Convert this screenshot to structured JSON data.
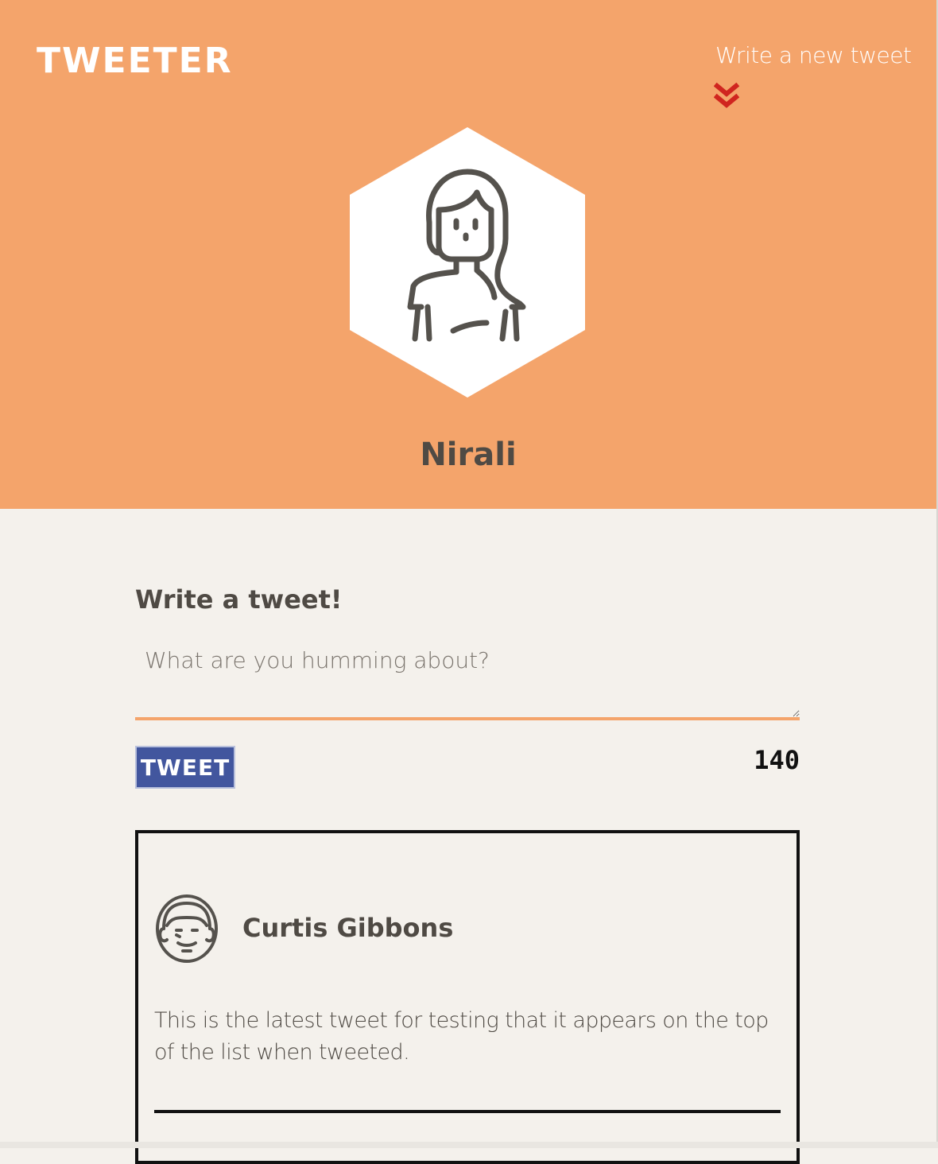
{
  "nav": {
    "logo": "TWEETER",
    "compose_link": "Write a new tweet",
    "compose_icon": "double-chevron-down-icon"
  },
  "profile": {
    "name": "Nirali",
    "avatar_icon": "woman-avatar-icon"
  },
  "compose": {
    "title": "Write a tweet!",
    "placeholder": "What are you humming about?",
    "button_label": "TWEET",
    "counter": "140"
  },
  "tweets": [
    {
      "author": "Curtis Gibbons",
      "avatar_icon": "man-avatar-icon",
      "text": "This is the latest tweet for testing that it appears on the top of the list when tweeted."
    }
  ],
  "colors": {
    "header_bg": "#f4a46b",
    "page_bg": "#f4f1ec",
    "button_bg": "#42569e",
    "chevron": "#d0251f",
    "text_dark": "#4f4a44"
  }
}
